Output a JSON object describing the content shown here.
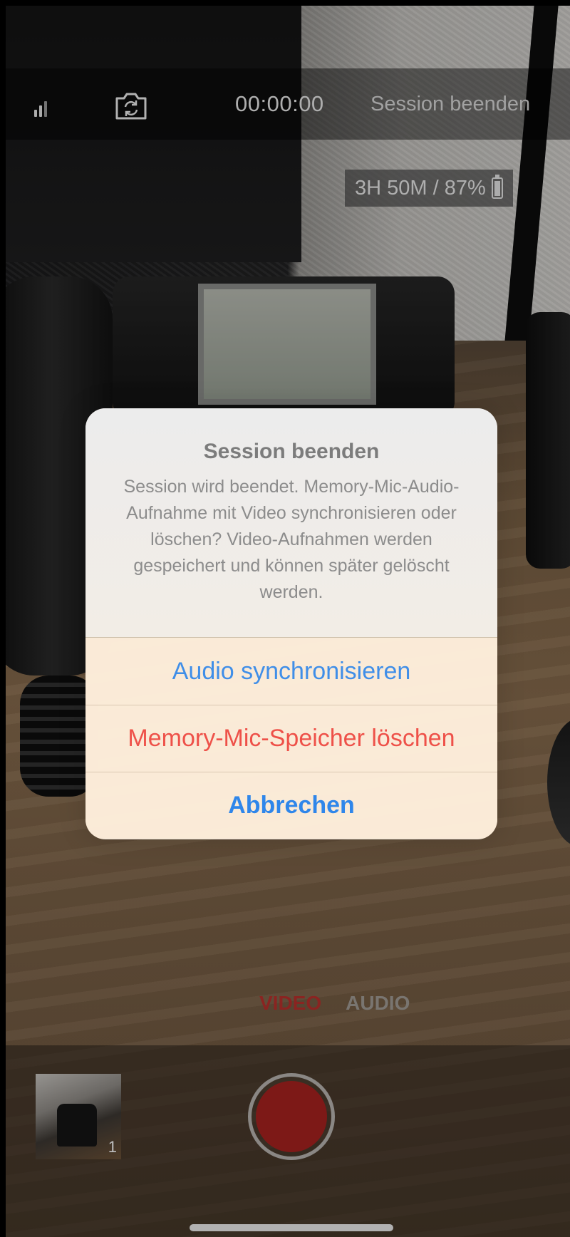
{
  "top_bar": {
    "signal_icon": "signal-bars-icon",
    "switch_camera_icon": "switch-camera-icon",
    "timer": "00:00:00",
    "end_session_label": "Session beenden"
  },
  "status": {
    "storage_text": "3H 50M / 87%",
    "battery_icon": "battery-icon",
    "battery_level_percent": 87
  },
  "alert": {
    "title": "Session beenden",
    "message": "Session wird beendet. Memory-Mic-Audio-Aufnahme mit Video synchronisieren oder löschen? Video-Aufnahmen werden gespeichert und können später gelöscht werden.",
    "buttons": {
      "sync": "Audio synchronisieren",
      "delete": "Memory-Mic-Speicher löschen",
      "cancel": "Abbrechen"
    }
  },
  "modes": {
    "video": "VIDEO",
    "audio": "AUDIO",
    "selected": "VIDEO"
  },
  "gallery": {
    "count": "1"
  },
  "colors": {
    "accent_blue": "#3f8ee8",
    "destructive_red": "#ee5149",
    "mode_selected_red": "#b9312d",
    "record_red": "#a7221f"
  }
}
